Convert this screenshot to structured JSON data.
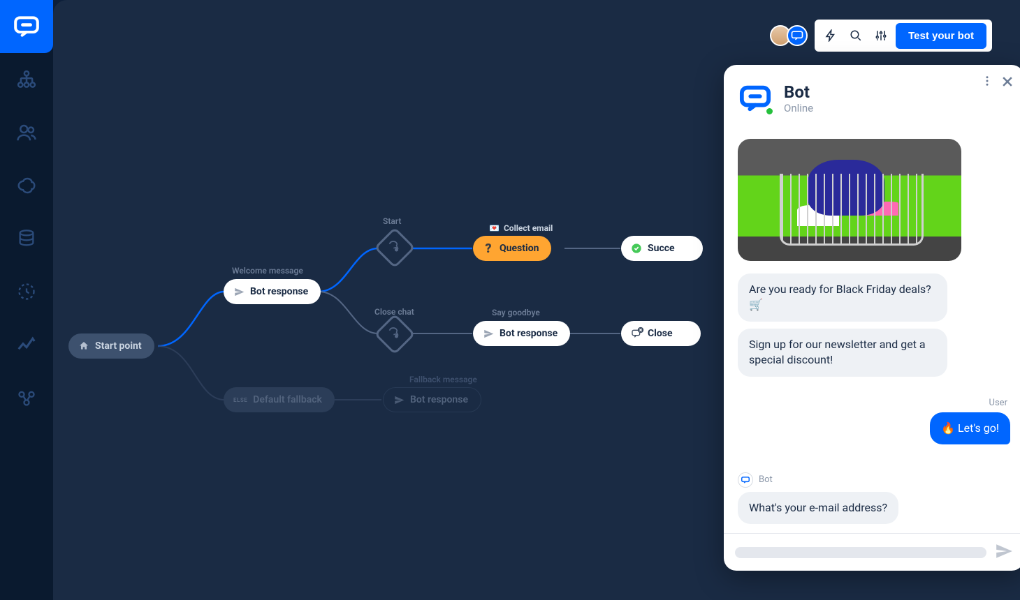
{
  "topbar": {
    "test_button": "Test your bot"
  },
  "flow": {
    "start_point": "Start point",
    "welcome_label": "Welcome message",
    "bot_response": "Bot response",
    "start_label": "Start",
    "collect_email": "Collect email",
    "question": "Question",
    "success": "Succe",
    "close_chat_label": "Close chat",
    "say_goodbye_label": "Say goodbye",
    "close_chat_action": "Close",
    "default_fallback": "Default fallback",
    "fallback_label": "Fallback message",
    "else": "ELSE"
  },
  "chat": {
    "title": "Bot",
    "status": "Online",
    "msg1": "Are you ready for Black Friday deals? 🛒",
    "msg2": "Sign up for our newsletter and get a special discount!",
    "user_label": "User",
    "user_msg": "🔥 Let's go!",
    "bot_label": "Bot",
    "msg3": "What's your e-mail address?"
  }
}
